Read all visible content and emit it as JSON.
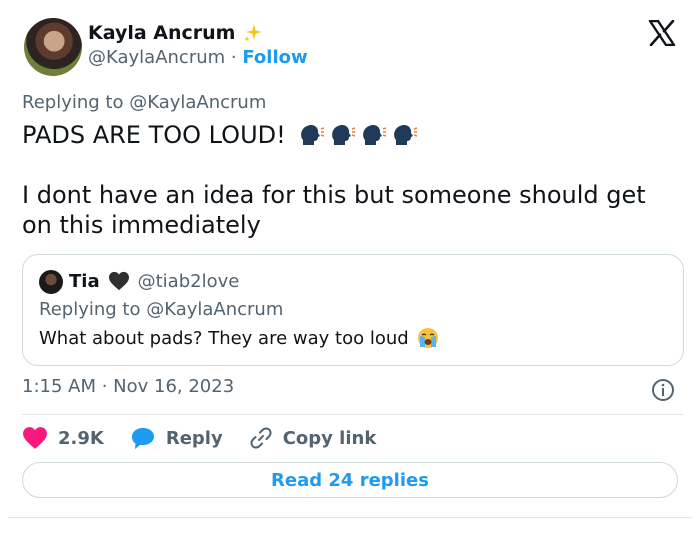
{
  "author": {
    "name": "Kayla Ancrum",
    "handle": "@KaylaAncrum",
    "separator": " · ",
    "follow_label": "Follow"
  },
  "tweet": {
    "replying_prefix": "Replying to ",
    "replying_to": "@KaylaAncrum",
    "line1": "PADS ARE TOO LOUD!",
    "line1_emojis": [
      "speaking-head-icon",
      "speaking-head-icon",
      "speaking-head-icon",
      "speaking-head-icon"
    ],
    "line2": "I dont have an idea for this but someone should get",
    "line3": "on this immediately"
  },
  "quote": {
    "name": "Tia",
    "handle": "@tiab2love",
    "replying_prefix": "Replying to ",
    "replying_to": "@KaylaAncrum",
    "text": "What about pads? They are way too loud"
  },
  "meta": {
    "timestamp": "1:15 AM · Nov 16, 2023"
  },
  "actions": {
    "likes": "2.9K",
    "reply_label": "Reply",
    "copy_link_label": "Copy link"
  },
  "footer": {
    "read_replies_label": "Read 24 replies"
  },
  "colors": {
    "accent": "#1d9bf0",
    "like": "#f91880",
    "muted": "#536471"
  }
}
